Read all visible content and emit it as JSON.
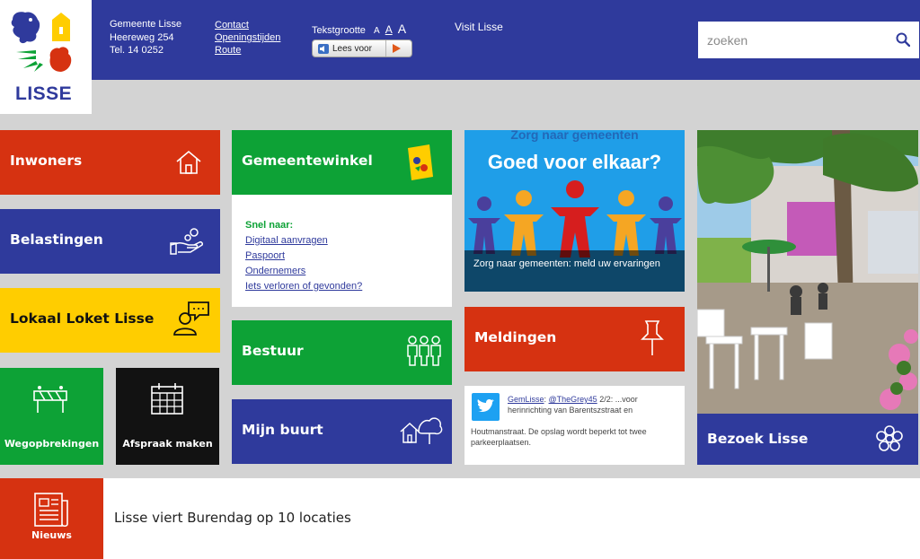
{
  "logo": {
    "text": "LISSE"
  },
  "address": {
    "line1": "Gemeente Lisse",
    "line2": "Heereweg 254",
    "line3": "Tel. 14 0252"
  },
  "header_links": [
    "Contact",
    "Openingstijden",
    "Route"
  ],
  "text_size": {
    "label": "Tekstgrootte",
    "small": "A",
    "medium": "A",
    "large": "A"
  },
  "read_aloud": {
    "label": "Lees voor"
  },
  "visit_link": "Visit Lisse",
  "search": {
    "placeholder": "zoeken"
  },
  "tiles": {
    "inwoners": "Inwoners",
    "belastingen": "Belastingen",
    "lokaal_loket": "Lokaal Loket Lisse",
    "wegopbrekingen": "Wegopbrekingen",
    "afspraak": "Afspraak maken",
    "gemeentewinkel": "Gemeentewinkel",
    "bestuur": "Bestuur",
    "mijn_buurt": "Mijn buurt",
    "meldingen": "Meldingen",
    "bezoek": "Bezoek Lisse",
    "nieuws": "Nieuws"
  },
  "quick_links": {
    "heading": "Snel naar:",
    "items": [
      "Digitaal aanvragen",
      "Paspoort",
      "Ondernemers",
      "Iets verloren of gevonden?"
    ]
  },
  "campaign": {
    "top": "Zorg naar gemeenten",
    "headline": "Goed voor elkaar?",
    "caption": "Zorg naar gemeenten: meld uw ervaringen"
  },
  "tweet": {
    "handle": "GemLisse",
    "mention": "@TheGrey45",
    "line1_rest": " 2/2: ...voor herinrichting van Barentszstraat en",
    "line2": "Houtmanstraat. De opslag wordt beperkt tot twee parkeerplaatsen."
  },
  "news": {
    "headline": "Lisse viert Burendag op 10 locaties"
  },
  "colors": {
    "blue": "#2f3a9c",
    "red": "#d63211",
    "green": "#0da236",
    "yellow": "#ffcd00",
    "black": "#121212"
  }
}
